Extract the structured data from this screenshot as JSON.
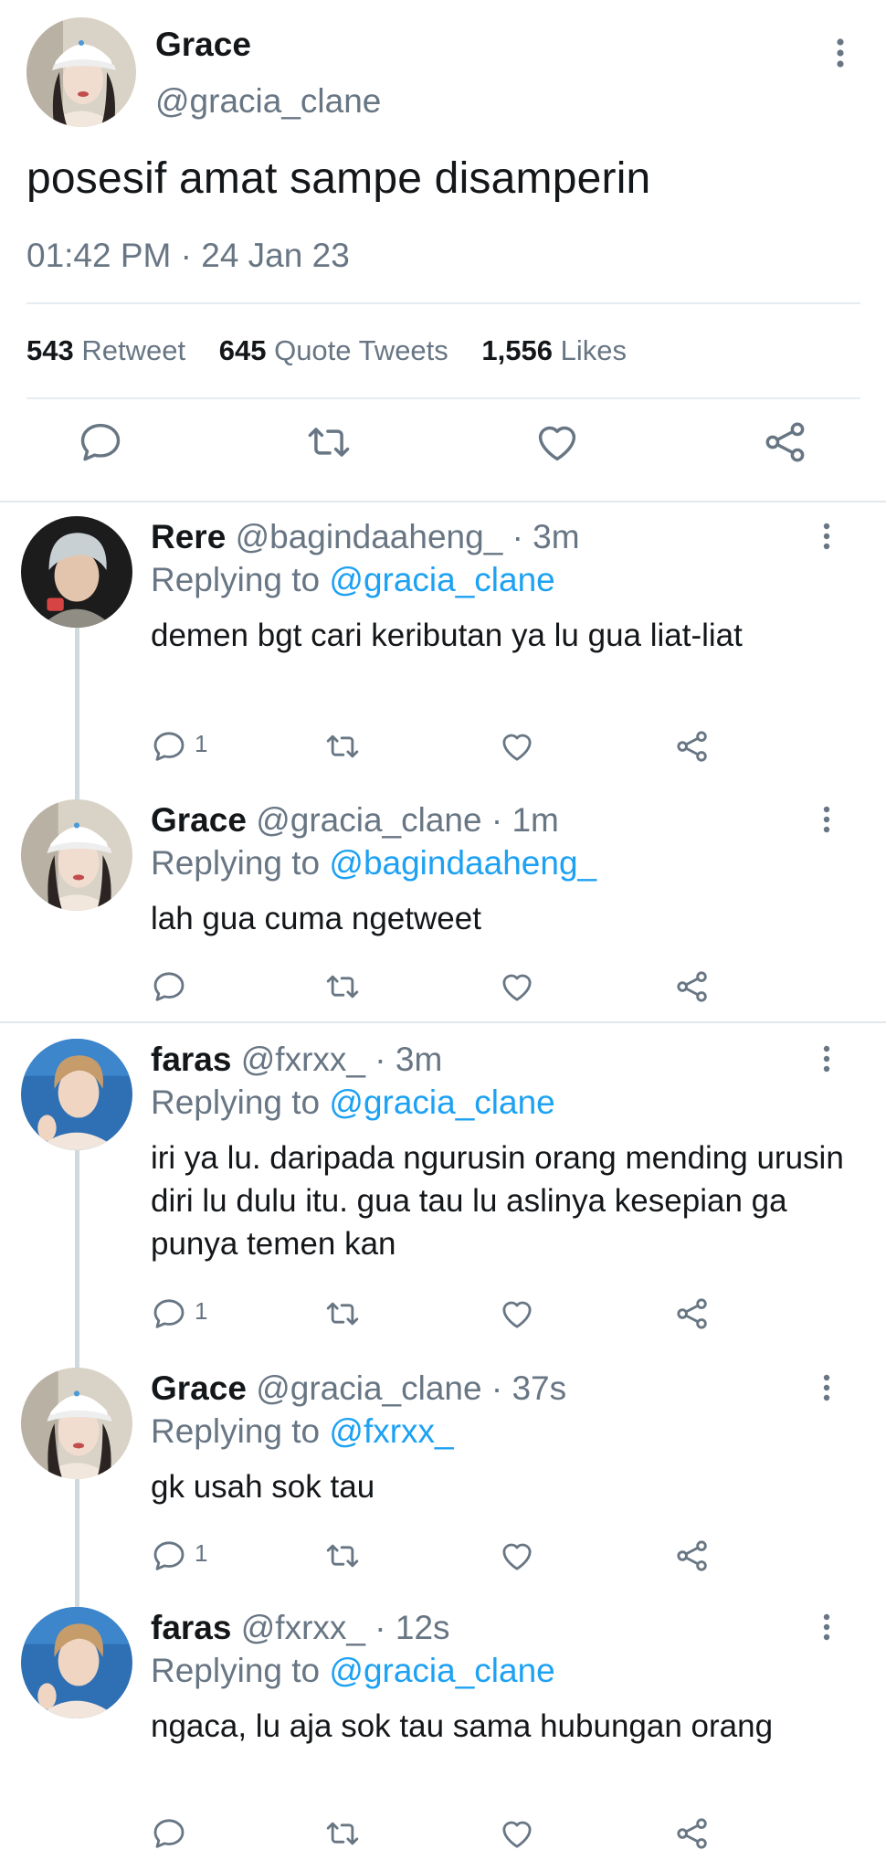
{
  "main_tweet": {
    "name": "Grace",
    "handle": "@gracia_clane",
    "text": "posesif amat sampe disamperin",
    "timestamp": "01:42 PM · 24 Jan 23",
    "stats": {
      "retweets_count": "543",
      "retweets_label": "Retweet",
      "quotes_count": "645",
      "quotes_label": "Quote Tweets",
      "likes_count": "1,556",
      "likes_label": "Likes"
    }
  },
  "replies": [
    {
      "name": "Rere",
      "handle": "@bagindaaheng_",
      "time": "· 3m",
      "replying_label": "Replying to",
      "replying_to": "@gracia_clane",
      "text": "demen bgt cari keributan ya lu gua liat-liat",
      "reply_count": "1"
    },
    {
      "name": "Grace",
      "handle": "@gracia_clane",
      "time": "· 1m",
      "replying_label": "Replying to",
      "replying_to": "@bagindaaheng_",
      "text": "lah gua cuma ngetweet",
      "reply_count": ""
    },
    {
      "name": "faras",
      "handle": "@fxrxx_",
      "time": "· 3m",
      "replying_label": "Replying to",
      "replying_to": "@gracia_clane",
      "text": "iri ya lu. daripada ngurusin orang mending urusin diri lu dulu itu. gua tau lu aslinya kesepian ga punya temen kan",
      "reply_count": "1"
    },
    {
      "name": "Grace",
      "handle": "@gracia_clane",
      "time": "· 37s",
      "replying_label": "Replying to",
      "replying_to": "@fxrxx_",
      "text": "gk usah sok tau",
      "reply_count": "1"
    },
    {
      "name": "faras",
      "handle": "@fxrxx_",
      "time": "· 12s",
      "replying_label": "Replying to",
      "replying_to": "@gracia_clane",
      "text": "ngaca, lu aja sok tau sama hubungan orang",
      "reply_count": ""
    }
  ],
  "icons": {
    "reply": "reply-icon",
    "retweet": "retweet-icon",
    "like": "heart-icon",
    "share": "share-icon",
    "more": "more-vertical-icon"
  },
  "colors": {
    "link": "#1da1f2",
    "secondary_text": "#687684",
    "primary_text": "#14171a",
    "divider": "#e6ecf0",
    "thread_line": "#cfd9de"
  }
}
